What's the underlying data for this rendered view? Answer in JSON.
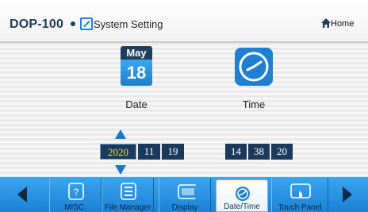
{
  "header": {
    "brand": "DOP-100",
    "title": "System Setting",
    "home_label": "Home"
  },
  "date_card": {
    "month": "May",
    "day": "18",
    "label": "Date"
  },
  "time_card": {
    "label": "Time"
  },
  "date_fields": {
    "year": "2020",
    "month": "11",
    "day": "19"
  },
  "time_fields": {
    "hour": "14",
    "minute": "38",
    "second": "20"
  },
  "tabs": [
    {
      "label": "MISC."
    },
    {
      "label": "File Manager"
    },
    {
      "label": "Display"
    },
    {
      "label": "Date/Time"
    },
    {
      "label": "Touch Panel"
    }
  ],
  "icons": {
    "settings": "system-setting-icon",
    "home": "home-icon",
    "calendar": "calendar-icon",
    "clock": "clock-icon",
    "prev": "left-arrow-icon",
    "next": "right-arrow-icon"
  },
  "colors": {
    "accent_blue": "#1c81d6",
    "field_bg": "#1c3a5c",
    "selected_text": "#f0e33a"
  }
}
